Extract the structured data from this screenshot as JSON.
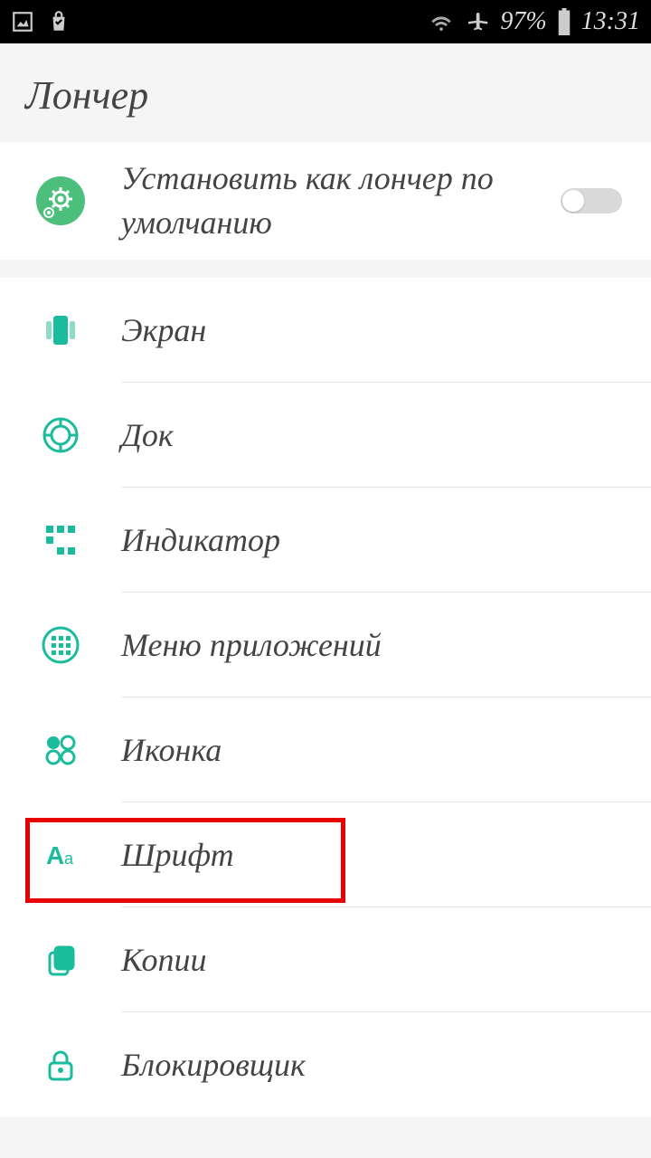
{
  "status": {
    "battery_pct": "97%",
    "time": "13:31"
  },
  "header": {
    "title": "Лончер"
  },
  "default_row": {
    "label": "Установить как лончер по умолчанию"
  },
  "items": [
    {
      "label": "Экран"
    },
    {
      "label": "Док"
    },
    {
      "label": "Индикатор"
    },
    {
      "label": "Меню приложений"
    },
    {
      "label": "Иконка"
    },
    {
      "label": "Шрифт"
    },
    {
      "label": "Копии"
    },
    {
      "label": "Блокировщик"
    }
  ],
  "colors": {
    "accent": "#1abc9c",
    "highlight": "#e60000"
  }
}
